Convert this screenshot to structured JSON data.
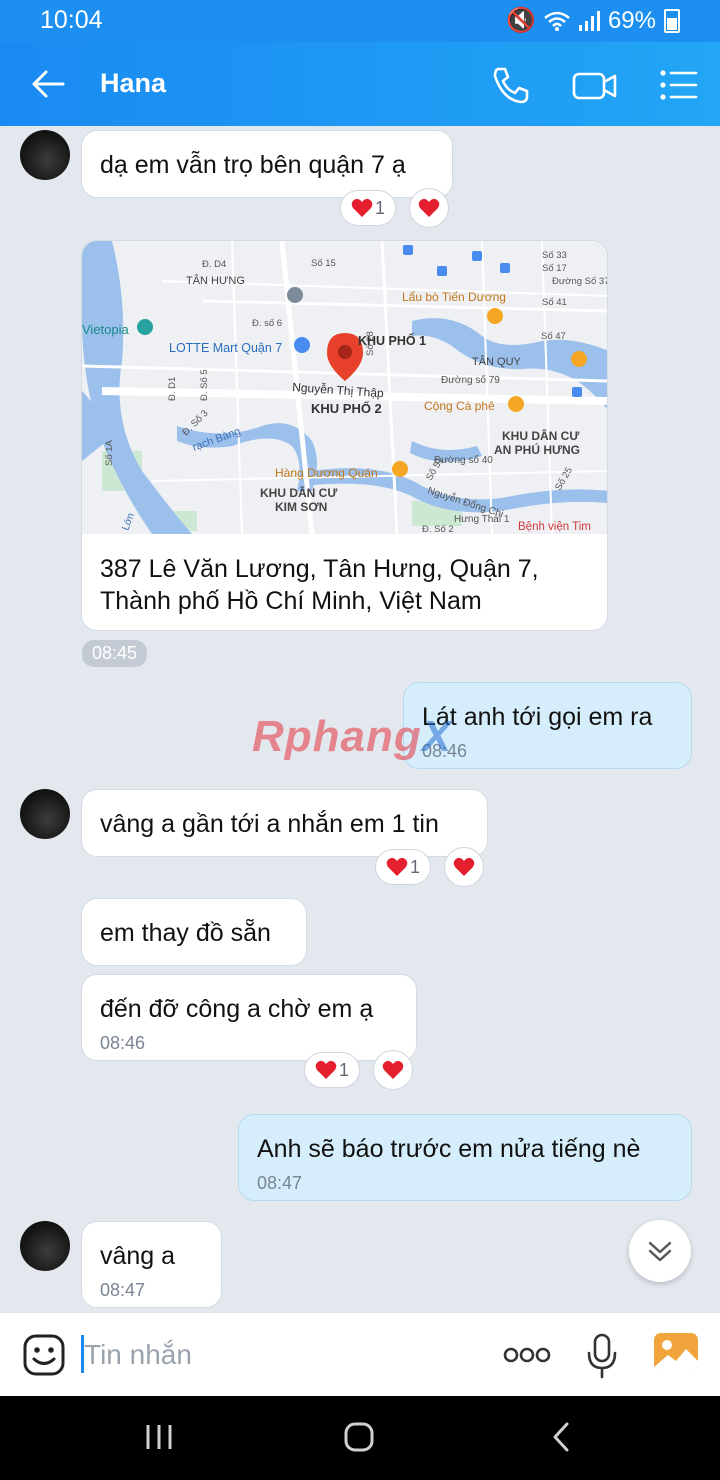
{
  "status_bar": {
    "time": "10:04",
    "battery": "69%"
  },
  "header": {
    "title": "Hana"
  },
  "messages": {
    "m1": {
      "text": "dạ em vẫn trọ bên quận 7 ạ",
      "reaction_count": "1"
    },
    "location": {
      "address_line1": "387 Lê Văn Lương, Tân Hưng, Quận 7,",
      "address_line2": "Thành phố Hồ Chí Minh, Việt Nam",
      "time": "08:45",
      "map_labels": {
        "lotte": "LOTTE Mart Quận 7",
        "vietopia": "Vietopia",
        "tan_hung": "TÂN HƯNG",
        "lau_bo": "Lẩu bò Tiến Dương",
        "khu_pho_1": "KHU PHỐ 1",
        "tan_quy": "TÂN QUY",
        "nguyen_thi_thap": "Nguyễn Thị Thập",
        "khu_pho_2": "KHU PHỐ 2",
        "cong_ca_phe": "Cộng Cà phê",
        "khu_dan_cu_an_phu_hung_1": "KHU DÂN CƯ",
        "khu_dan_cu_an_phu_hung_2": "AN PHÚ HƯNG",
        "hang_duong": "Hàng Dương Quán",
        "khu_dan_cu_kim_son_1": "KHU DÂN CƯ",
        "khu_dan_cu_kim_son_2": "KIM SƠN",
        "rach_bang": "rạch Bàng",
        "benh_vien": "Bệnh viện Tim",
        "nguyen_dong_chi": "Nguyễn Đổng Chi",
        "hung_thai": "Hưng Thái 1",
        "duong_so_79": "Đường số 79",
        "duong_so_40": "Đường số 40",
        "so_15": "Số 15",
        "so_28": "Số 28",
        "so_47": "Số 47",
        "so_41": "Số 41",
        "so_17": "Số 17",
        "so_33": "Số 33",
        "so_37": "Đường Số 37",
        "so_51": "Số 51",
        "so_25": "Số 25",
        "so_1a": "Số 1A",
        "d_d4": "Đ. D4",
        "d_so_6": "Đ. số 6",
        "d_so_5": "Đ. Số 5",
        "d_so_3": "Đ. Số 3",
        "d_d1": "Đ. D1",
        "d_so_2": "Đ. Số 2",
        "lon": "Lớn"
      }
    },
    "m2": {
      "text": "Lát anh tới gọi em ra",
      "time": "08:46"
    },
    "m3": {
      "text": "vâng a gần tới a nhắn em 1 tin",
      "reaction_count": "1"
    },
    "m4": {
      "text": "em thay đồ sẵn"
    },
    "m5": {
      "text": "đến đỡ công a chờ em ạ",
      "time": "08:46",
      "reaction_count": "1"
    },
    "m6": {
      "text": "Anh sẽ báo trước em nửa tiếng nè",
      "time": "08:47"
    },
    "m7": {
      "text": "vâng a",
      "time": "08:47"
    }
  },
  "watermark": {
    "part1": "Rphang",
    "part2": "X"
  },
  "input": {
    "placeholder": "Tin nhắn"
  },
  "colors": {
    "accent": "#1a8af2",
    "heart": "#e5202e",
    "outgoing_bubble": "#d6eefc"
  },
  "icons": [
    "back-arrow-icon",
    "phone-icon",
    "video-icon",
    "menu-icon",
    "heart-icon",
    "chevron-down-icon",
    "sticker-icon",
    "more-icon",
    "mic-icon",
    "image-icon"
  ]
}
